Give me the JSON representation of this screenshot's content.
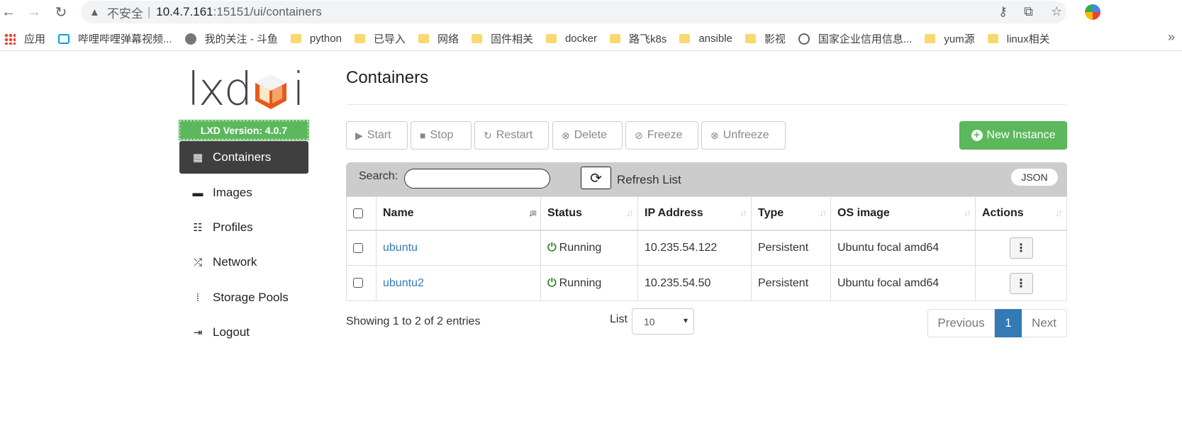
{
  "browser": {
    "insecure_label": "不安全",
    "separator": "|",
    "url_host": "10.4.7.161",
    "url_rest": ":15151/ui/containers",
    "bookmarks": [
      "应用",
      "哔哩哔哩弹幕视频...",
      "我的关注 - 斗鱼",
      "python",
      "已导入",
      "网络",
      "固件相关",
      "docker",
      "路飞k8s",
      "ansible",
      "影视",
      "国家企业信用信息...",
      "yum源",
      "linux相关"
    ],
    "more_label": "»"
  },
  "sidebar": {
    "logo_text": "lxd",
    "logo_text_end": "i",
    "version": "LXD Version: 4.0.7",
    "items": [
      {
        "label": "Containers",
        "icon": "grid-icon"
      },
      {
        "label": "Images",
        "icon": "hdd-icon"
      },
      {
        "label": "Profiles",
        "icon": "list-icon"
      },
      {
        "label": "Network",
        "icon": "shuffle-icon"
      },
      {
        "label": "Storage Pools",
        "icon": "tasks-icon"
      },
      {
        "label": "Logout",
        "icon": "logout-icon"
      }
    ]
  },
  "main": {
    "title": "Containers",
    "toolbar": {
      "start": "Start",
      "stop": "Stop",
      "restart": "Restart",
      "delete": "Delete",
      "freeze": "Freeze",
      "unfreeze": "Unfreeze",
      "new_instance": "New Instance"
    },
    "search": {
      "label": "Search:",
      "value": "",
      "refresh_label": "Refresh List",
      "json_label": "JSON"
    },
    "table": {
      "columns": [
        "Name",
        "Status",
        "IP Address",
        "Type",
        "OS image",
        "Actions"
      ],
      "rows": [
        {
          "name": "ubuntu",
          "status": "Running",
          "ip": "10.235.54.122",
          "type": "Persistent",
          "os": "Ubuntu focal amd64",
          "actions": "⋮"
        },
        {
          "name": "ubuntu2",
          "status": "Running",
          "ip": "10.235.54.50",
          "type": "Persistent",
          "os": "Ubuntu focal amd64",
          "actions": "⋮"
        }
      ]
    },
    "footer": {
      "showing": "Showing 1 to 2 of 2 entries",
      "list_label": "List",
      "page_size": "10",
      "previous": "Previous",
      "current_page": "1",
      "next": "Next"
    }
  },
  "colors": {
    "accent_green": "#5cb85c",
    "link_blue": "#337ab7",
    "running_green": "#2e8b2e",
    "sidebar_active": "#3f3f3f"
  }
}
